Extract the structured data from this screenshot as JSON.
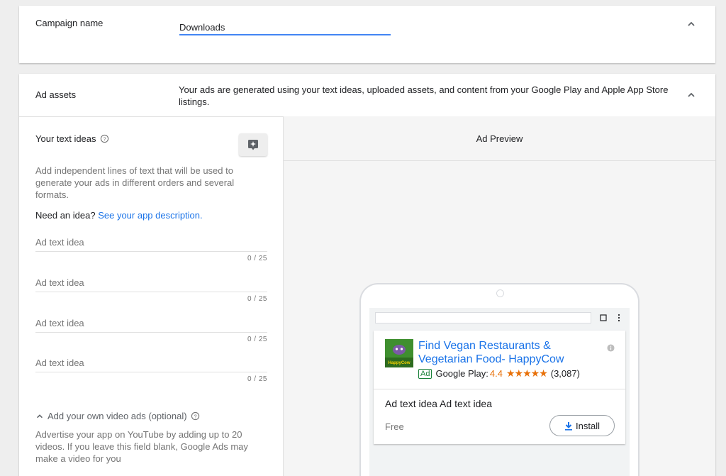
{
  "campaign": {
    "label": "Campaign name",
    "value": "Downloads"
  },
  "assets": {
    "label": "Ad assets",
    "description": "Your ads are generated using your text ideas, uploaded assets, and content from your Google Play and Apple App Store listings."
  },
  "text_ideas": {
    "title": "Your text ideas",
    "help_text": "Add independent lines of text that will be used to generate your ads in different orders and several formats.",
    "need_idea": "Need an idea?",
    "see_description_link": "See your app description.",
    "inputs": [
      {
        "placeholder": "Ad text idea",
        "counter": "0 / 25"
      },
      {
        "placeholder": "Ad text idea",
        "counter": "0 / 25"
      },
      {
        "placeholder": "Ad text idea",
        "counter": "0 / 25"
      },
      {
        "placeholder": "Ad text idea",
        "counter": "0 / 25"
      }
    ]
  },
  "video": {
    "toggle_label": "Add your own video ads (optional)",
    "help_text": "Advertise your app on YouTube by adding up to 20 videos. If you leave this field blank, Google Ads may make a video for you"
  },
  "preview": {
    "title": "Ad Preview",
    "app_title": "Find Vegan Restaurants & Vegetarian Food- HappyCow",
    "ad_badge": "Ad",
    "store_label": "Google Play:",
    "rating": "4.4",
    "stars": "★★★★★",
    "review_count": "(3,087)",
    "ad_text": "Ad text idea Ad text idea",
    "price": "Free",
    "install_label": "Install",
    "logo_text": "HappyCow"
  },
  "colors": {
    "accent": "#4285f4",
    "link": "#1a73e8",
    "rating": "#e8710a",
    "ad_badge": "#188038"
  }
}
